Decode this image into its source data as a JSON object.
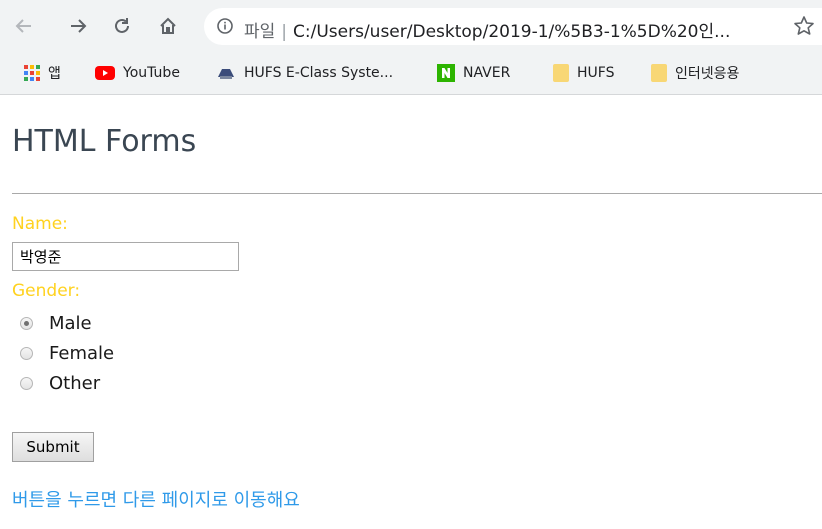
{
  "browser": {
    "url_scheme_label": "파일",
    "url_separator": "|",
    "url_path": "C:/Users/user/Desktop/2019-1/%5B3-1%5D%20인..."
  },
  "bookmarks": [
    {
      "label": "앱",
      "icon": "apps-grid-icon"
    },
    {
      "label": "YouTube",
      "icon": "youtube-icon"
    },
    {
      "label": "HUFS E-Class Syste...",
      "icon": "hufs-eclass-icon"
    },
    {
      "label": "NAVER",
      "icon": "naver-icon"
    },
    {
      "label": "HUFS",
      "icon": "folder-icon"
    },
    {
      "label": "인터넷응용",
      "icon": "folder-icon"
    }
  ],
  "page": {
    "title": "HTML Forms",
    "name_label": "Name:",
    "name_value": "박영준",
    "gender_label": "Gender:",
    "gender_options": [
      {
        "label": "Male",
        "checked": true
      },
      {
        "label": "Female",
        "checked": false
      },
      {
        "label": "Other",
        "checked": false
      }
    ],
    "submit_label": "Submit",
    "footer_text": "버튼을 누르면 다른 페이지로 이동해요"
  },
  "colors": {
    "label_yellow": "#ffd21f",
    "link_blue": "#2f9ae9",
    "title_text": "#3a4652",
    "chrome_bg": "#f1f3f4"
  }
}
